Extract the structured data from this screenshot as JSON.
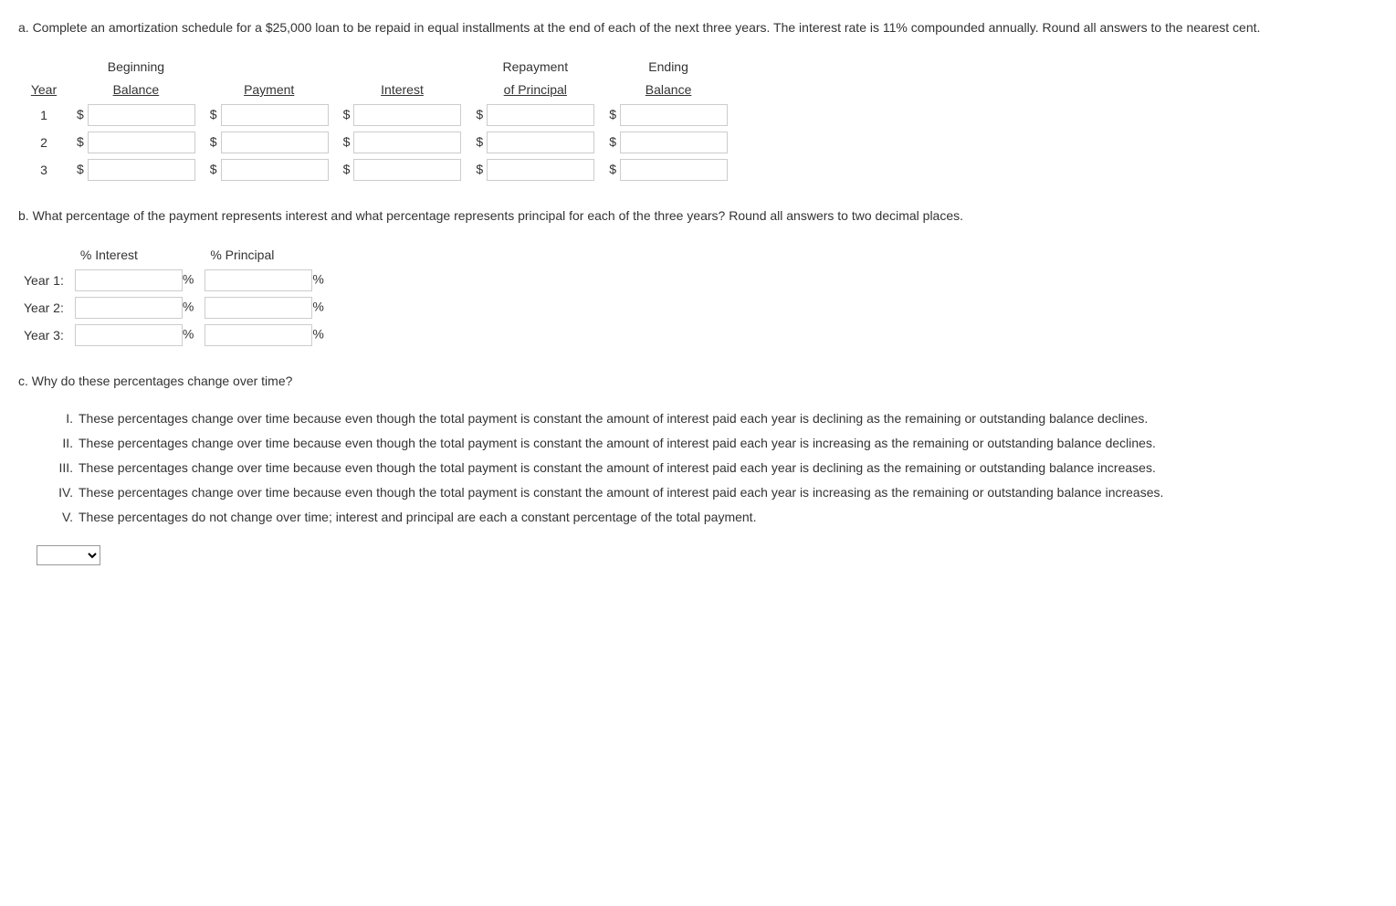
{
  "partA": {
    "prompt": "a. Complete an amortization schedule for a $25,000 loan to be repaid in equal installments at the end of each of the next three years. The interest rate is 11% compounded annually. Round all answers to the nearest cent.",
    "headers": {
      "year": "Year",
      "beginning_top": "Beginning",
      "beginning_bottom": "Balance",
      "payment": "Payment",
      "interest": "Interest",
      "repayment_top": "Repayment",
      "repayment_bottom": "of Principal",
      "ending_top": "Ending",
      "ending_bottom": "Balance"
    },
    "rows": [
      {
        "year": "1"
      },
      {
        "year": "2"
      },
      {
        "year": "3"
      }
    ],
    "currency": "$"
  },
  "partB": {
    "prompt": "b. What percentage of the payment represents interest and what percentage represents principal for each of the three years? Round all answers to two decimal places.",
    "headers": {
      "interest": "% Interest",
      "principal": "% Principal"
    },
    "rows": [
      {
        "label": "Year 1:"
      },
      {
        "label": "Year 2:"
      },
      {
        "label": "Year 3:"
      }
    ],
    "unit": "%"
  },
  "partC": {
    "prompt": "c. Why do these percentages change over time?",
    "options": [
      {
        "num": "I.",
        "text": "These percentages change over time because even though the total payment is constant the amount of interest paid each year is declining as the remaining or outstanding balance declines."
      },
      {
        "num": "II.",
        "text": "These percentages change over time because even though the total payment is constant the amount of interest paid each year is increasing as the remaining or outstanding balance declines."
      },
      {
        "num": "III.",
        "text": "These percentages change over time because even though the total payment is constant the amount of interest paid each year is declining as the remaining or outstanding balance increases."
      },
      {
        "num": "IV.",
        "text": "These percentages change over time because even though the total payment is constant the amount of interest paid each year is increasing as the remaining or outstanding balance increases."
      },
      {
        "num": "V.",
        "text": "These percentages do not change over time; interest and principal are each a constant percentage of the total payment."
      }
    ]
  }
}
